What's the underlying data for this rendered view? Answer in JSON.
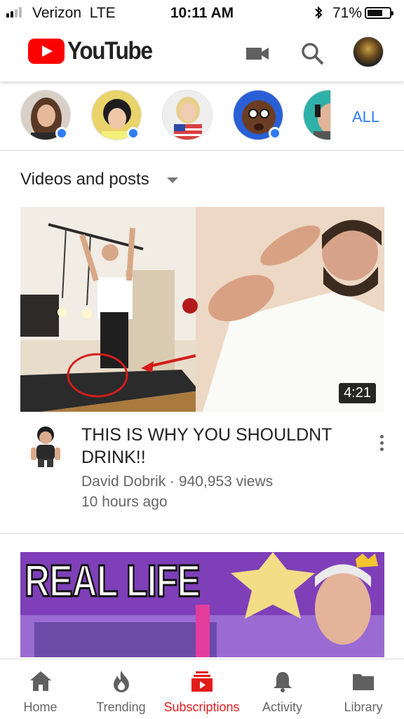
{
  "status_bar": {
    "carrier": "Verizon",
    "network": "LTE",
    "time": "10:11 AM",
    "battery_percent": "71%",
    "battery_level": 0.71
  },
  "header": {
    "logo_text": "YouTube"
  },
  "channels": {
    "all_label": "ALL",
    "accent_color": "#2f7cf6"
  },
  "section": {
    "title": "Videos and posts"
  },
  "video1": {
    "duration": "4:21",
    "title": "THIS IS WHY YOU SHOULDNT DRINK!!",
    "channel": "David Dobrik",
    "views": "940,953 views",
    "age": "10 hours ago"
  },
  "video2": {
    "thumbnail_text": "REAL LIFE"
  },
  "nav": {
    "active_color": "#e21b1b",
    "items": [
      {
        "label": "Home",
        "icon": "home-icon"
      },
      {
        "label": "Trending",
        "icon": "flame-icon"
      },
      {
        "label": "Subscriptions",
        "icon": "subscriptions-icon"
      },
      {
        "label": "Activity",
        "icon": "bell-icon"
      },
      {
        "label": "Library",
        "icon": "folder-icon"
      }
    ]
  }
}
